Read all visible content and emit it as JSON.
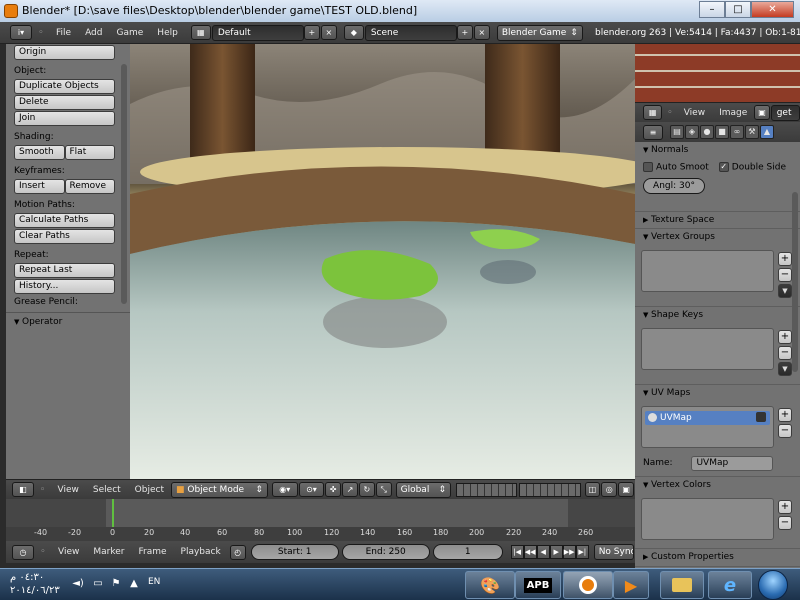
{
  "window": {
    "title": "Blender* [D:\\save files\\Desktop\\blender\\blender game\\TEST OLD.blend]",
    "minimize": "–",
    "maximize": "□",
    "close": "✕"
  },
  "info_header": {
    "menus": [
      "File",
      "Add",
      "Game",
      "Help"
    ],
    "screen_layout": "Default",
    "scene": "Scene",
    "engine": "Blender Game",
    "stats": "blender.org 263 | Ve:5414 | Fa:4437 | Ob:1-81"
  },
  "toolshelf": {
    "origin_button": "Origin",
    "object_label": "Object:",
    "duplicate_button": "Duplicate Objects",
    "delete_button": "Delete",
    "join_button": "Join",
    "shading_label": "Shading:",
    "smooth_button": "Smooth",
    "flat_button": "Flat",
    "keyframes_label": "Keyframes:",
    "insert_button": "Insert",
    "remove_button": "Remove",
    "motion_paths_label": "Motion Paths:",
    "calculate_paths_button": "Calculate Paths",
    "clear_paths_button": "Clear Paths",
    "repeat_label": "Repeat:",
    "repeat_last_button": "Repeat Last",
    "history_button": "History...",
    "grease_pencil_label": "Grease Pencil:",
    "operator_panel": "Operator"
  },
  "image_editor_header": {
    "view_menu": "View",
    "image_menu": "Image",
    "image_field": "get"
  },
  "properties": {
    "normals_panel": "Normals",
    "auto_smooth_label": "Auto Smoot",
    "double_sided_label": "Double Side",
    "angle_field": "Angl: 30°",
    "texture_space_panel": "Texture Space",
    "vertex_groups_panel": "Vertex Groups",
    "shape_keys_panel": "Shape Keys",
    "uv_maps_panel": "UV Maps",
    "uv_map_item": "UVMap",
    "name_label": "Name:",
    "name_value": "UVMap",
    "vertex_colors_panel": "Vertex Colors",
    "custom_properties_panel": "Custom Properties",
    "add_symbol": "+",
    "remove_symbol": "−",
    "down_symbol": "▼",
    "checkmark": "✓"
  },
  "view3d_header": {
    "view_menu": "View",
    "select_menu": "Select",
    "object_menu": "Object",
    "mode": "Object Mode",
    "orientation": "Global"
  },
  "timeline": {
    "ticks": [
      "-40",
      "-20",
      "0",
      "20",
      "40",
      "60",
      "80",
      "100",
      "120",
      "140",
      "160",
      "180",
      "200",
      "220",
      "240",
      "260"
    ],
    "current_frame_marker": 0
  },
  "timeline_header": {
    "view_menu": "View",
    "marker_menu": "Marker",
    "frame_menu": "Frame",
    "playback_menu": "Playback",
    "start_field": "Start: 1",
    "end_field": "End: 250",
    "current_frame": "1",
    "sync_mode": "No Sync"
  },
  "taskbar": {
    "clock_time": "٠٤:٣٠ م",
    "clock_date": "٢٠١٤/٠٦/٢٣",
    "language": "EN",
    "apb_label": "APB"
  }
}
